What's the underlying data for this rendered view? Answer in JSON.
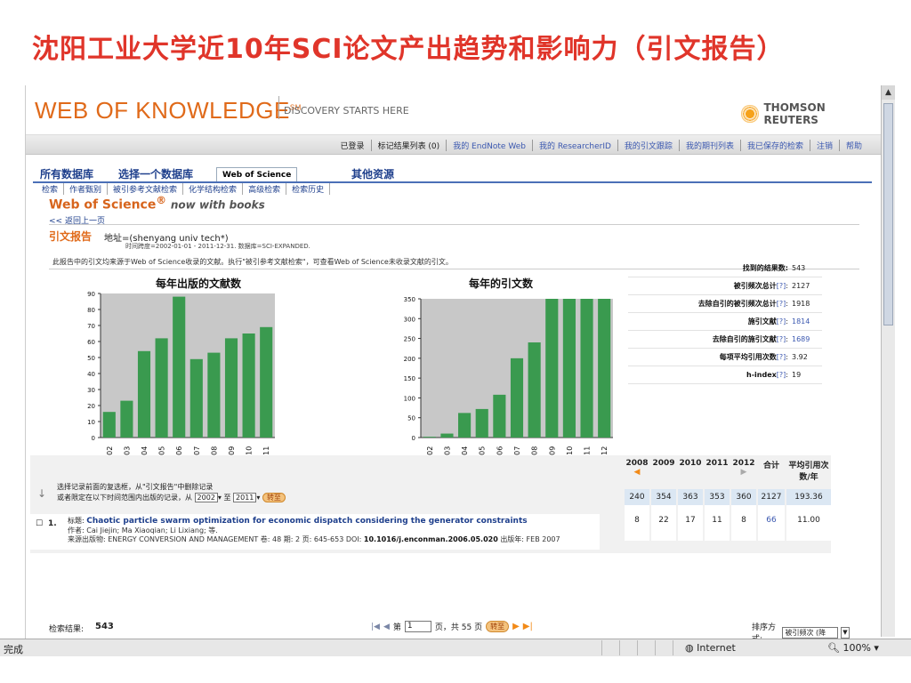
{
  "slide": {
    "title": "沈阳工业大学近10年SCI论文产出趋势和影响力（引文报告）"
  },
  "header": {
    "logo": "WEB OF KNOWLEDGE",
    "logo_mark": "SM",
    "tagline": "DISCOVERY STARTS HERE",
    "brand": "THOMSON REUTERS"
  },
  "user_nav": [
    "已登录",
    "标记结果列表 (0)",
    "我的 EndNote Web",
    "我的 ResearcherID",
    "我的引文跟踪",
    "我的期刊列表",
    "我已保存的检索",
    "注销",
    "帮助"
  ],
  "tabs": {
    "all_db": "所有数据库",
    "select_db": "选择一个数据库",
    "wos": "Web of Science",
    "other": "其他资源",
    "subtabs": [
      "检索",
      "作者甄别",
      "被引参考文献检索",
      "化学结构检索",
      "高级检索",
      "检索历史"
    ]
  },
  "page": {
    "wos_title": "Web of Science",
    "wos_reg": "®",
    "wos_sub": "now with books",
    "back": "<< 返回上一页",
    "report_label": "引文报告",
    "address": "地址=(shenyang univ tech*)",
    "timespan": "时间跨度=2002-01-01 - 2011-12-31. 数据库=SCI-EXPANDED.",
    "note": "此报告中的引文均来源于Web of Science收录的文献。执行\"被引参考文献检索\"，可查看Web of Science未收录文献的引文。"
  },
  "chart_data": [
    {
      "type": "bar",
      "title": "每年出版的文献数",
      "categories": [
        "2002",
        "2003",
        "2004",
        "2005",
        "2006",
        "2007",
        "2008",
        "2009",
        "2010",
        "2011"
      ],
      "values": [
        16,
        23,
        54,
        62,
        88,
        49,
        53,
        62,
        65,
        69
      ],
      "ylim": [
        0,
        90
      ],
      "yticks": [
        0,
        10,
        20,
        30,
        40,
        50,
        60,
        70,
        80,
        90
      ],
      "color": "#3a9a4f",
      "plot_bg": "#c8c8c8"
    },
    {
      "type": "bar",
      "title": "每年的引文数",
      "categories": [
        "2002",
        "2003",
        "2004",
        "2005",
        "2006",
        "2007",
        "2008",
        "2009",
        "2010",
        "2011",
        "2012"
      ],
      "values": [
        2,
        10,
        62,
        72,
        108,
        200,
        240,
        352,
        362,
        353,
        358
      ],
      "ylim": [
        0,
        350
      ],
      "yticks": [
        0,
        50,
        100,
        150,
        200,
        250,
        300,
        350
      ],
      "color": "#3a9a4f",
      "plot_bg": "#c8c8c8"
    }
  ],
  "stats": [
    {
      "label": "找到的结果数:",
      "help": "",
      "value": "543",
      "link": false
    },
    {
      "label": "被引频次总计",
      "help": "[?]",
      "value": "2127",
      "link": false
    },
    {
      "label": "去除自引的被引频次总计",
      "help": "[?]",
      "value": "1918",
      "link": false
    },
    {
      "label": "施引文献",
      "help": "[?]",
      "value": "1814",
      "link": true
    },
    {
      "label": "去除自引的施引文献",
      "help": "[?]",
      "value": "1689",
      "link": true
    },
    {
      "label": "每项平均引用次数",
      "help": "[?]",
      "value": "3.92",
      "link": false
    },
    {
      "label": "h-index",
      "help": "[?]",
      "value": "19",
      "link": false
    }
  ],
  "results": {
    "label": "检索结果:",
    "count": "543",
    "page_prefix": "第",
    "page_value": "1",
    "page_suffix": "页，共 55 页",
    "go": "转至",
    "sort_label": "排序方式:",
    "sort_value": "被引频次 (降序)"
  },
  "citation_table": {
    "instr1": "选择记录前面的复选框，从\"引文报告\"中删除记录",
    "instr2_a": "或者限定在以下时间范围内出版的记录，从",
    "from_year": "2002",
    "to_label": "至",
    "to_year": "2011",
    "go": "转至",
    "years": [
      "2008",
      "2009",
      "2010",
      "2011",
      "2012"
    ],
    "total_head": "合计",
    "avg_head": "平均引用次数/年",
    "year_totals": [
      "240",
      "354",
      "363",
      "353",
      "360"
    ],
    "grand_total": "2127",
    "grand_avg": "193.36"
  },
  "record": {
    "num": "1.",
    "title_prefix": "标题:",
    "title": "Chaotic particle swarm optimization for economic dispatch considering the generator constraints",
    "authors": "作者: Cai Jiejin; Ma Xiaoqian; Li Lixiang; 等.",
    "source_a": "来源出版物: ENERGY CONVERSION AND MANAGEMENT  卷: 48  期: 2  页: 645-653  DOI:",
    "doi": "10.1016/j.enconman.2006.05.020",
    "source_b": "出版年: FEB 2007",
    "years": [
      "8",
      "22",
      "17",
      "11",
      "8"
    ],
    "total": "66",
    "avg": "11.00"
  },
  "statusbar": {
    "done": "完成",
    "zone": "Internet",
    "zoom": "100%"
  }
}
